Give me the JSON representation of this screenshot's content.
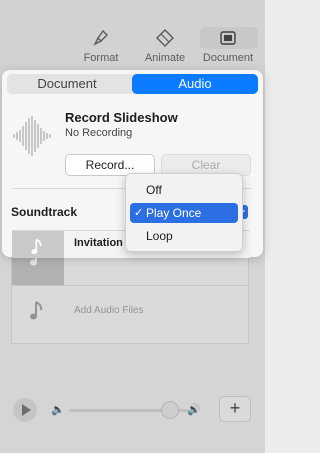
{
  "toolbar": {
    "items": [
      {
        "label": "Format",
        "icon": "paintbrush-icon"
      },
      {
        "label": "Animate",
        "icon": "diamond-icon"
      },
      {
        "label": "Document",
        "icon": "document-icon"
      }
    ]
  },
  "popover": {
    "tabs": [
      {
        "label": "Document",
        "selected": false
      },
      {
        "label": "Audio",
        "selected": true
      }
    ],
    "recording": {
      "title": "Record Slideshow",
      "status": "No Recording",
      "record_button": "Record...",
      "clear_button": "Clear"
    },
    "soundtrack": {
      "label": "Soundtrack",
      "options": [
        "Off",
        "Play Once",
        "Loop"
      ],
      "selected": "Play Once",
      "check": "✓"
    },
    "track": {
      "name": "Invitation"
    }
  },
  "background_list": {
    "add_label": "Add Audio Files"
  },
  "player": {
    "add_label": "+"
  },
  "colors": {
    "accent": "#0a7bff",
    "menu_highlight": "#2b6fe3"
  }
}
